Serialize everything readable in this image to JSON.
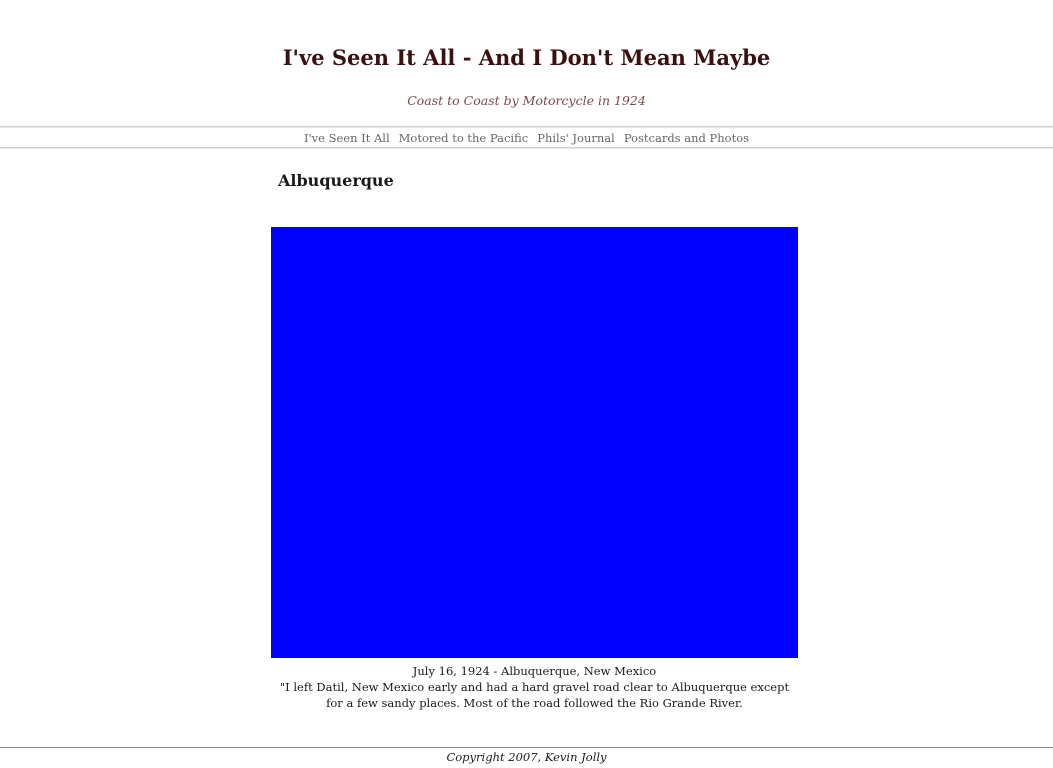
{
  "header": {
    "title": "I've Seen It All - And I Don't Mean Maybe",
    "tagline": "Coast to Coast by Motorcycle in 1924"
  },
  "nav": {
    "items": [
      {
        "label": "I've Seen It All"
      },
      {
        "label": "Motored to the Pacific"
      },
      {
        "label": "Phils' Journal"
      },
      {
        "label": "Postcards and Photos"
      }
    ]
  },
  "main": {
    "heading": "Albuquerque",
    "photo": {
      "fill_color": "#0000ff"
    },
    "caption": {
      "date_line": "July 16, 1924 - Albuquerque, New Mexico",
      "quote": "\"I left Datil, New Mexico early and had a hard gravel road clear to Albuquerque except for a few sandy places. Most of the road followed the Rio Grande River."
    }
  },
  "footer": {
    "copyright": "Copyright 2007, Kevin Jolly"
  }
}
